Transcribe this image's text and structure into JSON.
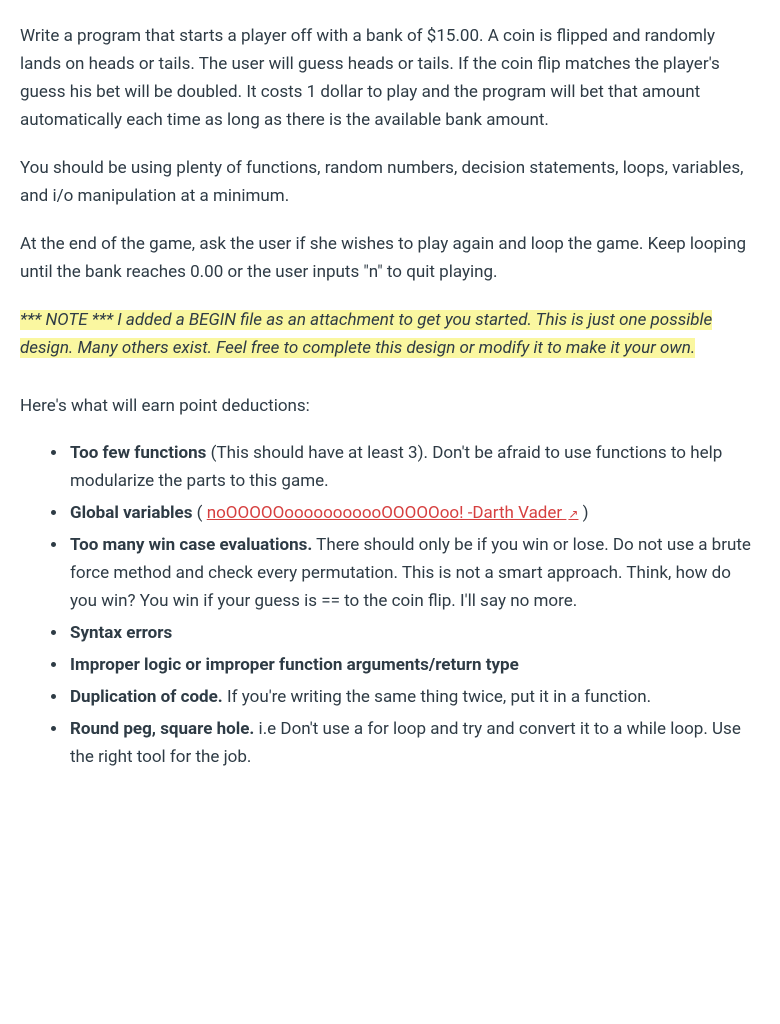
{
  "paragraphs": {
    "p1": "Write a program that starts a player off with a bank of $15.00. A coin is flipped and randomly lands on heads or tails. The user will guess heads or tails. If the coin flip matches the player's guess his bet will be doubled. It costs 1 dollar to play and the program will bet that amount automatically each time as long as there is the available bank amount.",
    "p2": "You should be using plenty of functions, random numbers, decision statements, loops, variables, and i/o manipulation at a minimum.",
    "p3": "At the end of the game, ask the user if she wishes to play again and loop the game. Keep looping until the bank reaches 0.00 or the user inputs \"n\" to quit playing.",
    "note": "*** NOTE *** I added a BEGIN file as an attachment to get you started. This is just one possible design. Many others exist. Feel free to complete this design or modify it to make it your own.",
    "deductions_intro": "Here's what will earn point deductions:"
  },
  "deductions": [
    {
      "bold": "Too few functions",
      "rest": " (This should have at least 3). Don't be afraid to use functions to help modularize the parts to this game."
    },
    {
      "bold": "Global variables",
      "rest_prefix": " ( ",
      "link_text": "noOOOOOooooooooooOOOOOoo!   -Darth Vader ",
      "rest_suffix": " )"
    },
    {
      "bold": "Too many win case evaluations.",
      "rest": " There should only be if you win or lose. Do not use a brute force method and check every permutation. This is not a smart approach. Think, how do you win? You win if your guess is == to the coin flip. I'll say no more."
    },
    {
      "bold": "Syntax errors",
      "rest": ""
    },
    {
      "bold": "Improper logic or improper function arguments/return type",
      "rest": ""
    },
    {
      "bold": "Duplication of code.",
      "rest": " If you're writing the same thing twice, put it in a function."
    },
    {
      "bold": "Round peg, square hole.",
      "rest": " i.e Don't use a for loop and try and convert it to a while loop. Use the right tool for the job."
    }
  ]
}
